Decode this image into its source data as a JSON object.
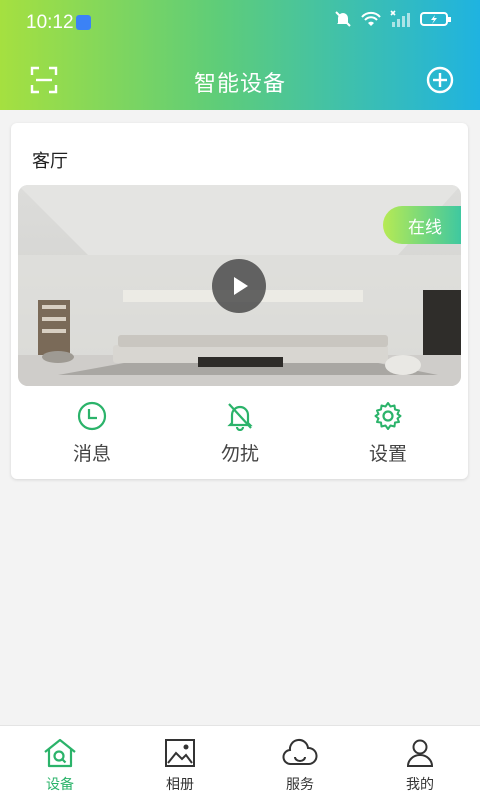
{
  "status": {
    "time": "10:12"
  },
  "header": {
    "title": "智能设备"
  },
  "device": {
    "room": "客厅",
    "status_badge": "在线"
  },
  "actions": [
    {
      "label": "消息",
      "icon": "clock-icon"
    },
    {
      "label": "勿扰",
      "icon": "bell-off-icon"
    },
    {
      "label": "设置",
      "icon": "gear-icon"
    }
  ],
  "tabs": [
    {
      "label": "设备",
      "icon": "home-search-icon",
      "active": true
    },
    {
      "label": "相册",
      "icon": "image-icon"
    },
    {
      "label": "服务",
      "icon": "cloud-icon"
    },
    {
      "label": "我的",
      "icon": "user-icon"
    }
  ],
  "colors": {
    "accent": "#2bb36a",
    "gradient_start": "#a5e040",
    "gradient_end": "#1fb3e0"
  }
}
